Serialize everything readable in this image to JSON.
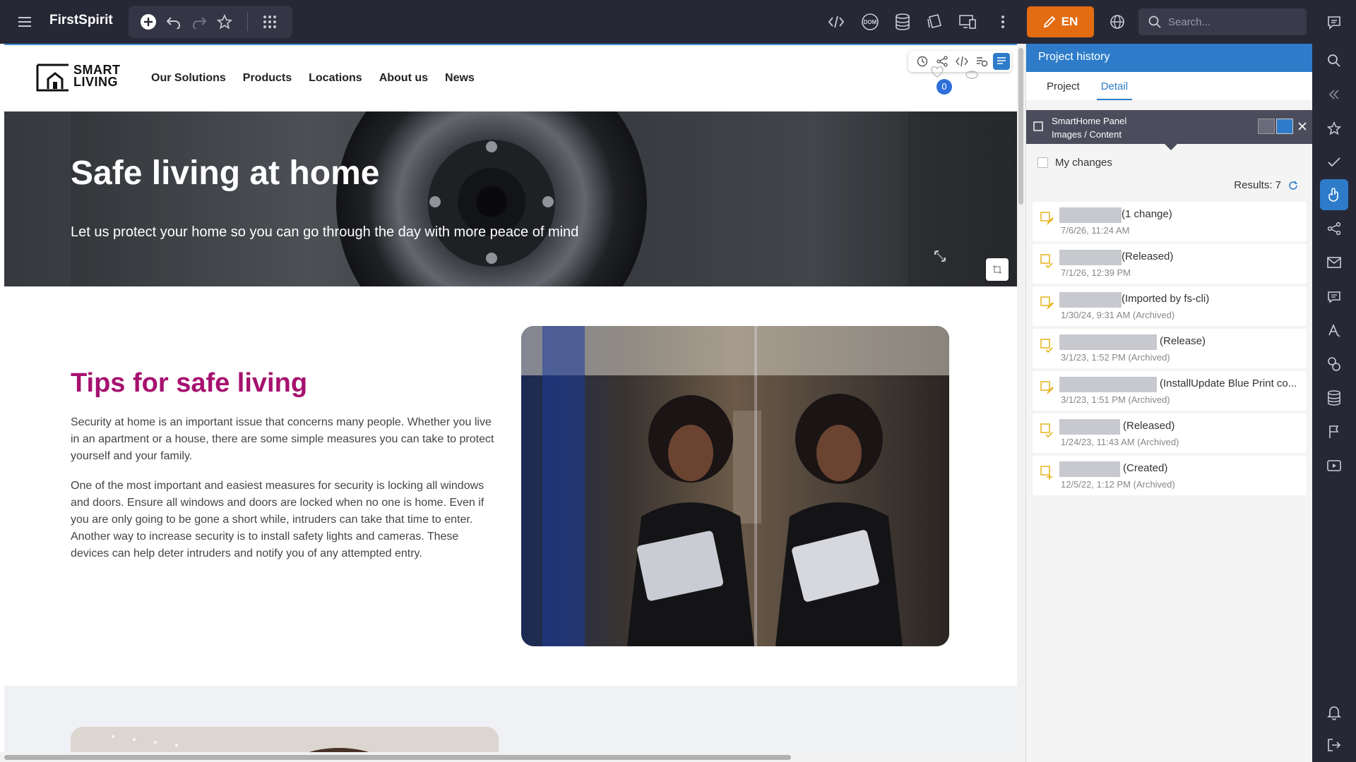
{
  "app": {
    "title": "FirstSpirit",
    "language": "EN",
    "search_placeholder": "Search..."
  },
  "site": {
    "logo_line1": "SMART",
    "logo_line2": "LIVING",
    "nav": [
      "Our Solutions",
      "Products",
      "Locations",
      "About us",
      "News"
    ],
    "badge_count": "0",
    "hero_title": "Safe living at home",
    "hero_subtitle": "Let us protect your home so you can go through the day with more peace of mind",
    "tips_title": "Tips for safe living",
    "tips_p1": "Security at home is an important issue that concerns many people. Whether you live in an apartment or a house, there are some simple measures you can take to protect yourself and your family.",
    "tips_p2": "One of the most important and easiest measures for security is locking all windows and doors. Ensure all windows and doors are locked when no one is home. Even if you are only going to be gone a short while, intruders can take that time to enter. Another way to increase security is to install safety lights and cameras. These devices can help deter intruders and notify you of any attempted entry."
  },
  "panel": {
    "title": "Project history",
    "tabs": [
      "Project",
      "Detail"
    ],
    "active_tab": "Detail",
    "context_line1": "SmartHome Panel",
    "context_line2": "Images / Content",
    "my_changes_label": "My changes",
    "results_label": "Results: 7",
    "entries": [
      {
        "action": "(1 change)",
        "date": "7/6/26, 11:24 AM"
      },
      {
        "action": "(Released)",
        "date": "7/1/26, 12:39 PM"
      },
      {
        "action": "(Imported by fs-cli)",
        "date": "1/30/24, 9:31 AM (Archived)"
      },
      {
        "action": "(Release)",
        "date": "3/1/23, 1:52 PM (Archived)"
      },
      {
        "action": "(InstallUpdate Blue Print co...",
        "date": "3/1/23, 1:51 PM (Archived)"
      },
      {
        "action": "(Released)",
        "date": "1/24/23, 11:43 AM (Archived)"
      },
      {
        "action": "(Created)",
        "date": "12/5/22, 1:12 PM (Archived)"
      }
    ]
  },
  "colors": {
    "accent": "#2e7cc9",
    "brand_orange": "#e36c12",
    "tips_title": "#a6116e",
    "topbar": "#272836"
  }
}
